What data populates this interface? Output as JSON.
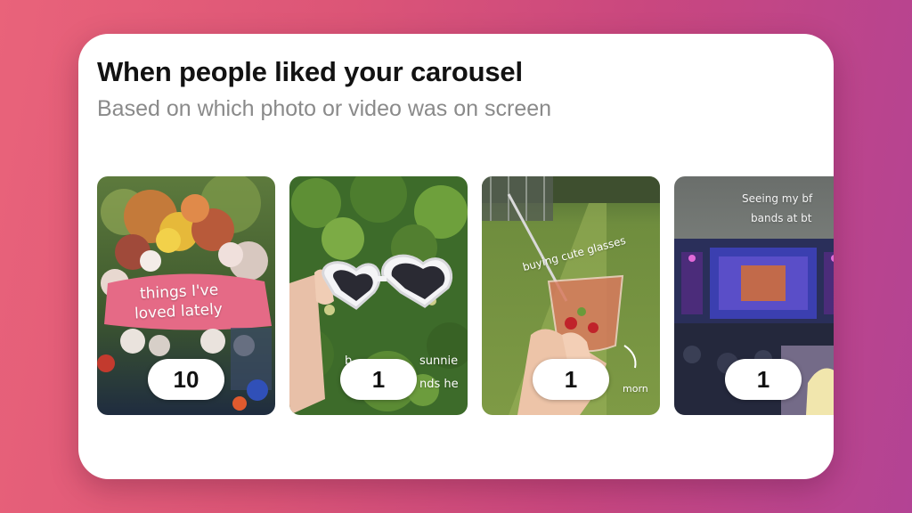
{
  "header": {
    "title": "When people liked your carousel",
    "subtitle": "Based on which photo or video was on screen"
  },
  "slides": [
    {
      "label": "Flower bouquet photo",
      "overlay_text": [
        "things I've",
        "loved lately"
      ],
      "likes": "10"
    },
    {
      "label": "Heart sunglasses photo",
      "overlay_text": [
        "b",
        "sunnie",
        "nds he"
      ],
      "likes": "1"
    },
    {
      "label": "Drink glass photo",
      "overlay_text": [
        "buying cute glasses",
        "morn"
      ],
      "likes": "1"
    },
    {
      "label": "Concert stage photo",
      "overlay_text": [
        "Seeing my bf",
        "bands at bt"
      ],
      "likes": "1"
    }
  ],
  "colors": {
    "background_start": "#e9637a",
    "background_end": "#b34394",
    "card": "#ffffff",
    "title": "#121212",
    "subtitle": "#8a8a8a"
  }
}
